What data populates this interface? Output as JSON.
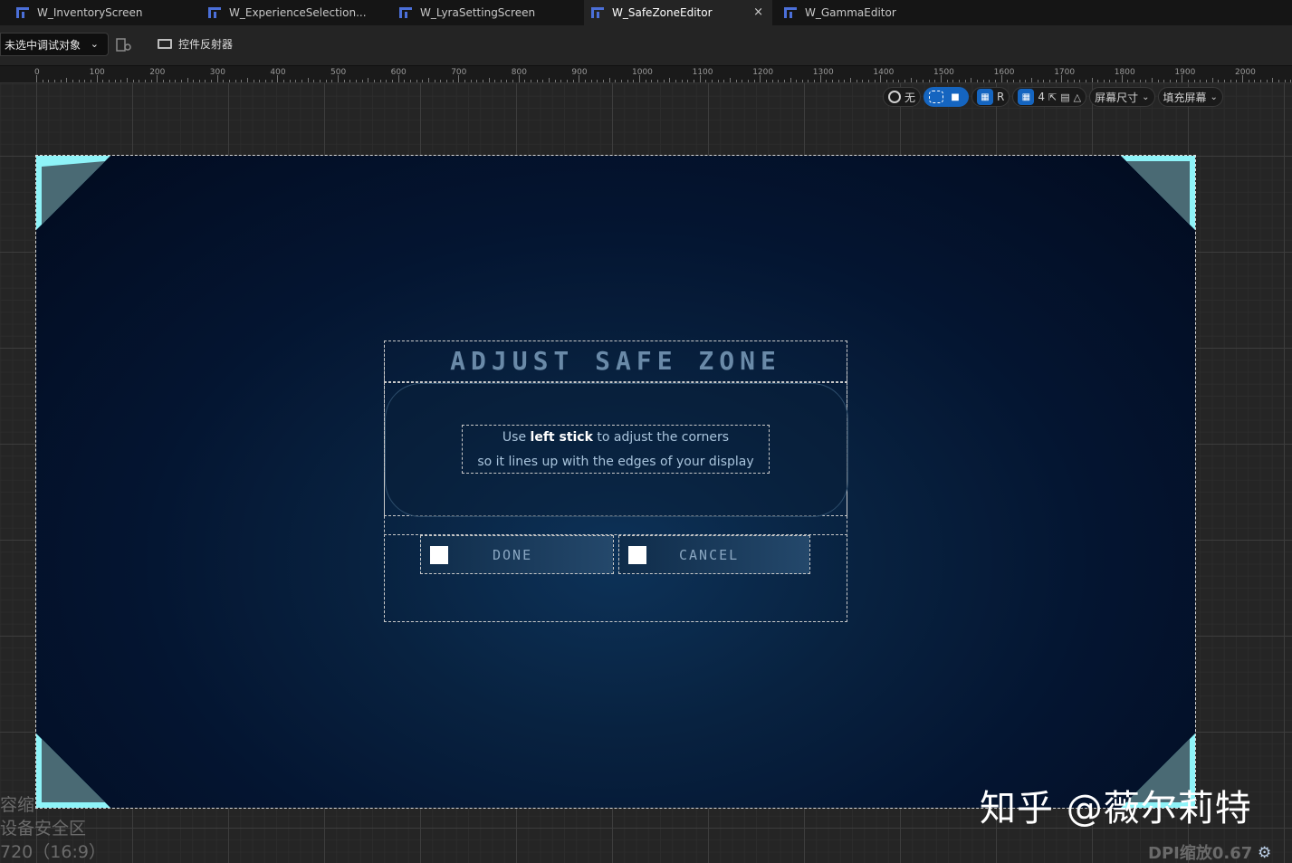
{
  "tabs": [
    {
      "label": "W_InventoryScreen",
      "active": false
    },
    {
      "label": "W_ExperienceSelection...",
      "active": false
    },
    {
      "label": "W_LyraSettingScreen",
      "active": false
    },
    {
      "label": "W_SafeZoneEditor",
      "active": true
    },
    {
      "label": "W_GammaEditor",
      "active": false
    }
  ],
  "tab_close_glyph": "×",
  "toolbar": {
    "debug_target": "未选中调试对象",
    "reflector_label": "控件反射器"
  },
  "ruler_labels": [
    "0",
    "100",
    "200",
    "300",
    "400",
    "500",
    "600",
    "700",
    "800",
    "900",
    "1000",
    "1100",
    "1200",
    "1300",
    "1400",
    "1500",
    "1600",
    "1700",
    "1800",
    "1900",
    "2000"
  ],
  "view_toolbar": {
    "localization": "无",
    "r_label": "R",
    "grid_count": "4",
    "screen_size": "屏幕尺寸",
    "fill_screen": "填充屏幕"
  },
  "safe_zone": {
    "title": "ADJUST SAFE ZONE",
    "line1_pre": "Use ",
    "line1_bold": "left stick",
    "line1_post": " to adjust the corners",
    "line2": "so it lines up with the edges of your display",
    "done_label": "DONE",
    "cancel_label": "CANCEL"
  },
  "overlay": {
    "line1": "容缩",
    "line2": "设备安全区",
    "line3": "720（16:9）"
  },
  "watermark": "知乎 @薇尔莉特",
  "dpi_label": "DPI缩放0.67",
  "colors": {
    "accent": "#1565c0",
    "corner": "#8ef3f8",
    "tab_icon": "#4b6fd8"
  }
}
